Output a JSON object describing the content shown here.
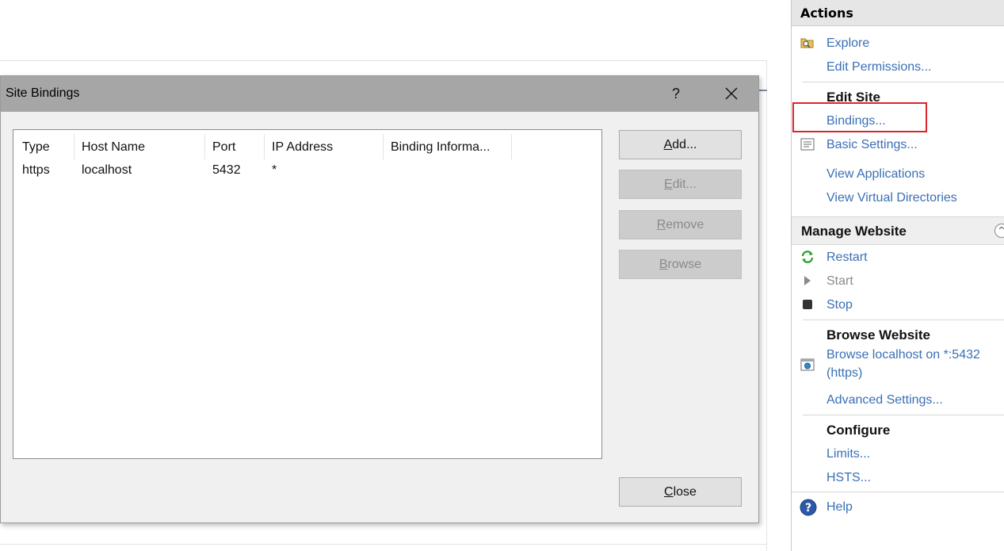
{
  "dialog": {
    "title": "Site Bindings",
    "help_label": "?",
    "close_icon": "close-icon",
    "columns": [
      "Type",
      "Host Name",
      "Port",
      "IP Address",
      "Binding Informa..."
    ],
    "rows": [
      {
        "type": "https",
        "host": "localhost",
        "port": "5432",
        "ip": "*",
        "info": ""
      }
    ],
    "buttons": {
      "add": {
        "access": "A",
        "rest": "dd..."
      },
      "edit": {
        "access": "E",
        "rest": "dit..."
      },
      "remove": {
        "access": "R",
        "rest": "emove"
      },
      "browse": {
        "access": "B",
        "rest": "rowse"
      },
      "close": {
        "access": "C",
        "rest": "lose"
      }
    }
  },
  "actions": {
    "header": "Actions",
    "explore": "Explore",
    "edit_permissions": "Edit Permissions...",
    "edit_site": {
      "title": "Edit Site",
      "bindings": "Bindings...",
      "basic_settings": "Basic Settings...",
      "view_applications": "View Applications",
      "view_virtual_directories": "View Virtual Directories"
    },
    "manage_website": {
      "title": "Manage Website",
      "restart": "Restart",
      "start": "Start",
      "stop": "Stop"
    },
    "browse_website": {
      "title": "Browse Website",
      "browse_line1": "Browse localhost on *:5432",
      "browse_line2": "(https)",
      "advanced_settings": "Advanced Settings..."
    },
    "configure": {
      "title": "Configure",
      "limits": "Limits...",
      "hsts": "HSTS..."
    },
    "help": "Help"
  },
  "colors": {
    "link": "#3a6fb5",
    "highlight": "#d9262b",
    "titlebar": "#a6a6a6"
  }
}
